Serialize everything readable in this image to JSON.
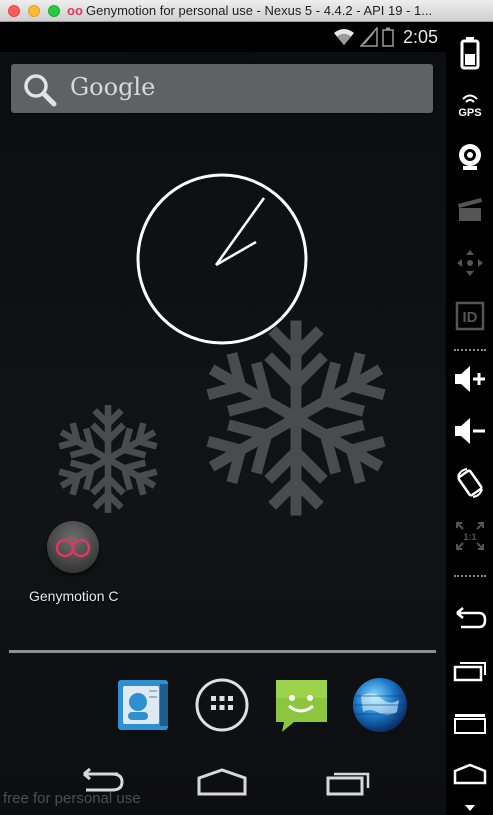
{
  "window": {
    "title": "Genymotion for personal use - Nexus 5 - 4.4.2 - API 19 - 1..."
  },
  "status_bar": {
    "time": "2:05",
    "icons": [
      "wifi-icon",
      "signal-icon",
      "battery-icon"
    ]
  },
  "search": {
    "label": "Google"
  },
  "home": {
    "apps": [
      {
        "label": "Genymotion C",
        "icon": "genymotion-icon"
      }
    ],
    "dock": [
      {
        "name": "contacts-icon"
      },
      {
        "name": "all-apps-icon"
      },
      {
        "name": "messaging-icon"
      },
      {
        "name": "browser-icon"
      }
    ]
  },
  "nav": {
    "buttons": [
      "back-icon",
      "home-icon",
      "recents-icon"
    ]
  },
  "watermark": "free for personal use",
  "sidebar": {
    "buttons": [
      {
        "name": "battery-icon"
      },
      {
        "name": "gps-icon",
        "label": "GPS"
      },
      {
        "name": "webcam-icon"
      },
      {
        "name": "screencast-icon"
      },
      {
        "name": "dpad-icon"
      },
      {
        "name": "id-icon",
        "label": "ID"
      },
      {
        "name": "volume-up-icon"
      },
      {
        "name": "volume-down-icon"
      },
      {
        "name": "rotate-icon"
      },
      {
        "name": "pixel-perfect-icon",
        "label": "1:1"
      },
      {
        "name": "back-icon"
      },
      {
        "name": "recents-icon"
      },
      {
        "name": "menu-icon"
      },
      {
        "name": "home-icon"
      }
    ]
  },
  "colors": {
    "accent": "#e0375e",
    "sidebar_icon": "#ffffff",
    "disabled_icon": "#555555"
  }
}
